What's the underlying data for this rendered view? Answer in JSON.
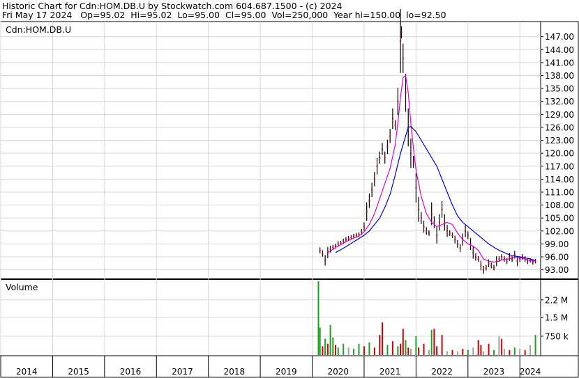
{
  "header": {
    "line1": "Historic Chart for Cdn:HOM.DB.U by Stockwatch.com 604.687.1500 - (c) 2024",
    "line2": "Fri May 17 2024   Op=95.02  Hi=95.02  Lo=95.00  Cl=95.00  Vol=250,000  Year hi=150.00  lo=92.50"
  },
  "chart_data": [
    {
      "type": "line",
      "title": "Cdn:HOM.DB.U",
      "price_ylim": [
        91.0,
        150.5
      ],
      "yticks": [
        "147.00",
        "144.00",
        "141.00",
        "138.00",
        "135.00",
        "132.00",
        "129.00",
        "126.00",
        "123.00",
        "120.00",
        "117.00",
        "114.00",
        "111.00",
        "108.00",
        "105.00",
        "102.00",
        "99.00",
        "96.00",
        "93.00"
      ],
      "ytick_values": [
        147,
        144,
        141,
        138,
        135,
        132,
        129,
        126,
        123,
        120,
        117,
        114,
        111,
        108,
        105,
        102,
        99,
        96,
        93
      ],
      "x_range": [
        2014.0,
        2024.4
      ],
      "price_points": [
        [
          2020.15,
          97.5
        ],
        [
          2020.2,
          96.8
        ],
        [
          2020.25,
          95.2
        ],
        [
          2020.3,
          97.0
        ],
        [
          2020.35,
          97.8
        ],
        [
          2020.4,
          98.2
        ],
        [
          2020.45,
          98.5
        ],
        [
          2020.5,
          99.0
        ],
        [
          2020.55,
          99.2
        ],
        [
          2020.6,
          99.6
        ],
        [
          2020.65,
          100.0
        ],
        [
          2020.7,
          100.3
        ],
        [
          2020.75,
          100.5
        ],
        [
          2020.8,
          100.8
        ],
        [
          2020.85,
          101.0
        ],
        [
          2020.9,
          101.2
        ],
        [
          2020.95,
          101.8
        ],
        [
          2021.0,
          103.0
        ],
        [
          2021.05,
          106.5
        ],
        [
          2021.1,
          109.0
        ],
        [
          2021.15,
          111.5
        ],
        [
          2021.2,
          114.0
        ],
        [
          2021.25,
          117.0
        ],
        [
          2021.3,
          119.0
        ],
        [
          2021.35,
          121.0
        ],
        [
          2021.4,
          119.0
        ],
        [
          2021.45,
          121.5
        ],
        [
          2021.5,
          124.0
        ],
        [
          2021.55,
          128.0
        ],
        [
          2021.6,
          126.5
        ],
        [
          2021.65,
          132.0
        ],
        [
          2021.7,
          146.0
        ],
        [
          2021.72,
          148.0
        ],
        [
          2021.75,
          142.0
        ],
        [
          2021.8,
          134.0
        ],
        [
          2021.85,
          126.0
        ],
        [
          2021.9,
          120.0
        ],
        [
          2021.95,
          118.0
        ],
        [
          2022.0,
          112.0
        ],
        [
          2022.05,
          107.0
        ],
        [
          2022.1,
          105.0
        ],
        [
          2022.15,
          103.0
        ],
        [
          2022.2,
          102.0
        ],
        [
          2022.25,
          101.5
        ],
        [
          2022.3,
          106.0
        ],
        [
          2022.35,
          104.0
        ],
        [
          2022.4,
          101.0
        ],
        [
          2022.45,
          104.0
        ],
        [
          2022.5,
          107.0
        ],
        [
          2022.55,
          104.0
        ],
        [
          2022.6,
          102.0
        ],
        [
          2022.65,
          101.5
        ],
        [
          2022.7,
          101.0
        ],
        [
          2022.75,
          100.0
        ],
        [
          2022.8,
          99.0
        ],
        [
          2022.85,
          98.0
        ],
        [
          2022.9,
          100.0
        ],
        [
          2022.95,
          102.0
        ],
        [
          2023.0,
          101.0
        ],
        [
          2023.05,
          99.0
        ],
        [
          2023.1,
          97.0
        ],
        [
          2023.15,
          96.0
        ],
        [
          2023.2,
          95.5
        ],
        [
          2023.25,
          94.0
        ],
        [
          2023.3,
          93.0
        ],
        [
          2023.35,
          93.5
        ],
        [
          2023.4,
          94.5
        ],
        [
          2023.45,
          94.0
        ],
        [
          2023.5,
          93.5
        ],
        [
          2023.55,
          95.0
        ],
        [
          2023.6,
          95.5
        ],
        [
          2023.65,
          96.0
        ],
        [
          2023.7,
          95.5
        ],
        [
          2023.75,
          95.0
        ],
        [
          2023.8,
          96.0
        ],
        [
          2023.85,
          95.5
        ],
        [
          2023.9,
          96.5
        ],
        [
          2023.95,
          95.0
        ],
        [
          2024.0,
          95.5
        ],
        [
          2024.05,
          96.0
        ],
        [
          2024.1,
          95.5
        ],
        [
          2024.15,
          95.0
        ],
        [
          2024.2,
          95.2
        ],
        [
          2024.25,
          94.8
        ],
        [
          2024.3,
          95.0
        ]
      ],
      "series": [
        {
          "name": "",
          "color": "#e000e0",
          "values": [
            [
              2020.3,
              97.0
            ],
            [
              2020.5,
              98.5
            ],
            [
              2020.7,
              99.8
            ],
            [
              2020.9,
              100.8
            ],
            [
              2021.0,
              101.8
            ],
            [
              2021.1,
              103.5
            ],
            [
              2021.2,
              106.0
            ],
            [
              2021.3,
              109.5
            ],
            [
              2021.4,
              113.0
            ],
            [
              2021.5,
              116.5
            ],
            [
              2021.6,
              122.0
            ],
            [
              2021.65,
              127.0
            ],
            [
              2021.7,
              133.0
            ],
            [
              2021.75,
              137.5
            ],
            [
              2021.8,
              138.0
            ],
            [
              2021.85,
              134.0
            ],
            [
              2021.9,
              127.0
            ],
            [
              2021.95,
              121.0
            ],
            [
              2022.0,
              116.0
            ],
            [
              2022.1,
              110.0
            ],
            [
              2022.2,
              106.0
            ],
            [
              2022.3,
              104.0
            ],
            [
              2022.4,
              103.0
            ],
            [
              2022.5,
              103.5
            ],
            [
              2022.6,
              104.0
            ],
            [
              2022.7,
              103.5
            ],
            [
              2022.8,
              101.5
            ],
            [
              2022.9,
              100.0
            ],
            [
              2023.0,
              99.0
            ],
            [
              2023.1,
              98.5
            ],
            [
              2023.2,
              97.5
            ],
            [
              2023.3,
              95.5
            ],
            [
              2023.4,
              95.0
            ],
            [
              2023.5,
              94.8
            ],
            [
              2023.6,
              95.0
            ],
            [
              2023.7,
              95.5
            ],
            [
              2023.8,
              95.5
            ],
            [
              2023.9,
              96.0
            ],
            [
              2024.0,
              95.8
            ],
            [
              2024.1,
              95.5
            ],
            [
              2024.2,
              95.2
            ],
            [
              2024.3,
              95.0
            ]
          ]
        },
        {
          "name": "",
          "color": "#0000e0",
          "values": [
            [
              2020.45,
              97.0
            ],
            [
              2020.6,
              98.0
            ],
            [
              2020.8,
              99.5
            ],
            [
              2021.0,
              101.0
            ],
            [
              2021.1,
              102.0
            ],
            [
              2021.2,
              103.5
            ],
            [
              2021.3,
              105.0
            ],
            [
              2021.4,
              107.5
            ],
            [
              2021.5,
              110.5
            ],
            [
              2021.6,
              115.0
            ],
            [
              2021.7,
              120.0
            ],
            [
              2021.8,
              124.0
            ],
            [
              2021.85,
              126.0
            ],
            [
              2021.9,
              126.2
            ],
            [
              2022.0,
              125.0
            ],
            [
              2022.1,
              123.0
            ],
            [
              2022.2,
              121.0
            ],
            [
              2022.3,
              119.0
            ],
            [
              2022.4,
              117.0
            ],
            [
              2022.5,
              114.0
            ],
            [
              2022.6,
              111.0
            ],
            [
              2022.7,
              108.0
            ],
            [
              2022.8,
              105.5
            ],
            [
              2022.9,
              104.0
            ],
            [
              2023.0,
              103.0
            ],
            [
              2023.1,
              102.0
            ],
            [
              2023.2,
              101.0
            ],
            [
              2023.3,
              100.0
            ],
            [
              2023.4,
              99.0
            ],
            [
              2023.5,
              98.2
            ],
            [
              2023.6,
              97.5
            ],
            [
              2023.7,
              97.0
            ],
            [
              2023.8,
              96.5
            ],
            [
              2023.9,
              96.2
            ],
            [
              2024.0,
              96.0
            ],
            [
              2024.1,
              95.8
            ],
            [
              2024.2,
              95.5
            ],
            [
              2024.3,
              95.2
            ]
          ]
        }
      ]
    },
    {
      "type": "bar",
      "title": "Volume",
      "yticks": [
        "2.2 M",
        "1.5 M",
        "750 k"
      ],
      "ytick_values": [
        2200000,
        1500000,
        750000
      ],
      "ylim": [
        0,
        3000000
      ],
      "bars": [
        [
          2020.12,
          2950000,
          "#20a020"
        ],
        [
          2020.15,
          1100000,
          "#20a020"
        ],
        [
          2020.2,
          350000,
          "#d00000"
        ],
        [
          2020.25,
          650000,
          "#20a020"
        ],
        [
          2020.3,
          450000,
          "#d00000"
        ],
        [
          2020.35,
          1200000,
          "#20a020"
        ],
        [
          2020.4,
          700000,
          "#20a020"
        ],
        [
          2020.45,
          400000,
          "#d00000"
        ],
        [
          2020.5,
          300000,
          "#20a020"
        ],
        [
          2020.6,
          450000,
          "#20a020"
        ],
        [
          2020.7,
          300000,
          "#a0a0a0"
        ],
        [
          2020.8,
          250000,
          "#20a020"
        ],
        [
          2020.9,
          450000,
          "#20a020"
        ],
        [
          2021.0,
          350000,
          "#d00000"
        ],
        [
          2021.1,
          500000,
          "#20a020"
        ],
        [
          2021.2,
          300000,
          "#d00000"
        ],
        [
          2021.3,
          800000,
          "#d00000"
        ],
        [
          2021.35,
          1300000,
          "#d00000"
        ],
        [
          2021.45,
          400000,
          "#20a020"
        ],
        [
          2021.55,
          550000,
          "#d00000"
        ],
        [
          2021.65,
          350000,
          "#20a020"
        ],
        [
          2021.7,
          450000,
          "#d00000"
        ],
        [
          2021.75,
          1050000,
          "#d00000"
        ],
        [
          2021.8,
          600000,
          "#20a020"
        ],
        [
          2021.85,
          300000,
          "#d00000"
        ],
        [
          2021.9,
          250000,
          "#a0a0a0"
        ],
        [
          2022.0,
          750000,
          "#20a020"
        ],
        [
          2022.05,
          300000,
          "#d00000"
        ],
        [
          2022.15,
          450000,
          "#d00000"
        ],
        [
          2022.25,
          200000,
          "#a0a0a0"
        ],
        [
          2022.3,
          1000000,
          "#20a020"
        ],
        [
          2022.35,
          1050000,
          "#d00000"
        ],
        [
          2022.4,
          350000,
          "#d00000"
        ],
        [
          2022.5,
          800000,
          "#d00000"
        ],
        [
          2022.6,
          150000,
          "#a0a0a0"
        ],
        [
          2022.7,
          200000,
          "#d00000"
        ],
        [
          2022.8,
          150000,
          "#a0a0a0"
        ],
        [
          2022.9,
          250000,
          "#d00000"
        ],
        [
          2023.0,
          200000,
          "#20a020"
        ],
        [
          2023.1,
          300000,
          "#a0a0a0"
        ],
        [
          2023.2,
          600000,
          "#d00000"
        ],
        [
          2023.25,
          400000,
          "#d00000"
        ],
        [
          2023.3,
          150000,
          "#a0a0a0"
        ],
        [
          2023.4,
          450000,
          "#d00000"
        ],
        [
          2023.5,
          200000,
          "#20a020"
        ],
        [
          2023.6,
          750000,
          "#a0a0a0"
        ],
        [
          2023.65,
          650000,
          "#d00000"
        ],
        [
          2023.7,
          250000,
          "#a0a0a0"
        ],
        [
          2023.8,
          200000,
          "#d00000"
        ],
        [
          2023.9,
          300000,
          "#20a020"
        ],
        [
          2024.0,
          250000,
          "#a0a0a0"
        ],
        [
          2024.1,
          200000,
          "#d00000"
        ],
        [
          2024.2,
          400000,
          "#a0a0a0"
        ],
        [
          2024.3,
          800000,
          "#20a020"
        ]
      ]
    }
  ],
  "xaxis": {
    "years": [
      "2014",
      "2015",
      "2016",
      "2017",
      "2018",
      "2019",
      "2020",
      "2021",
      "2022",
      "2023",
      "2024"
    ]
  }
}
